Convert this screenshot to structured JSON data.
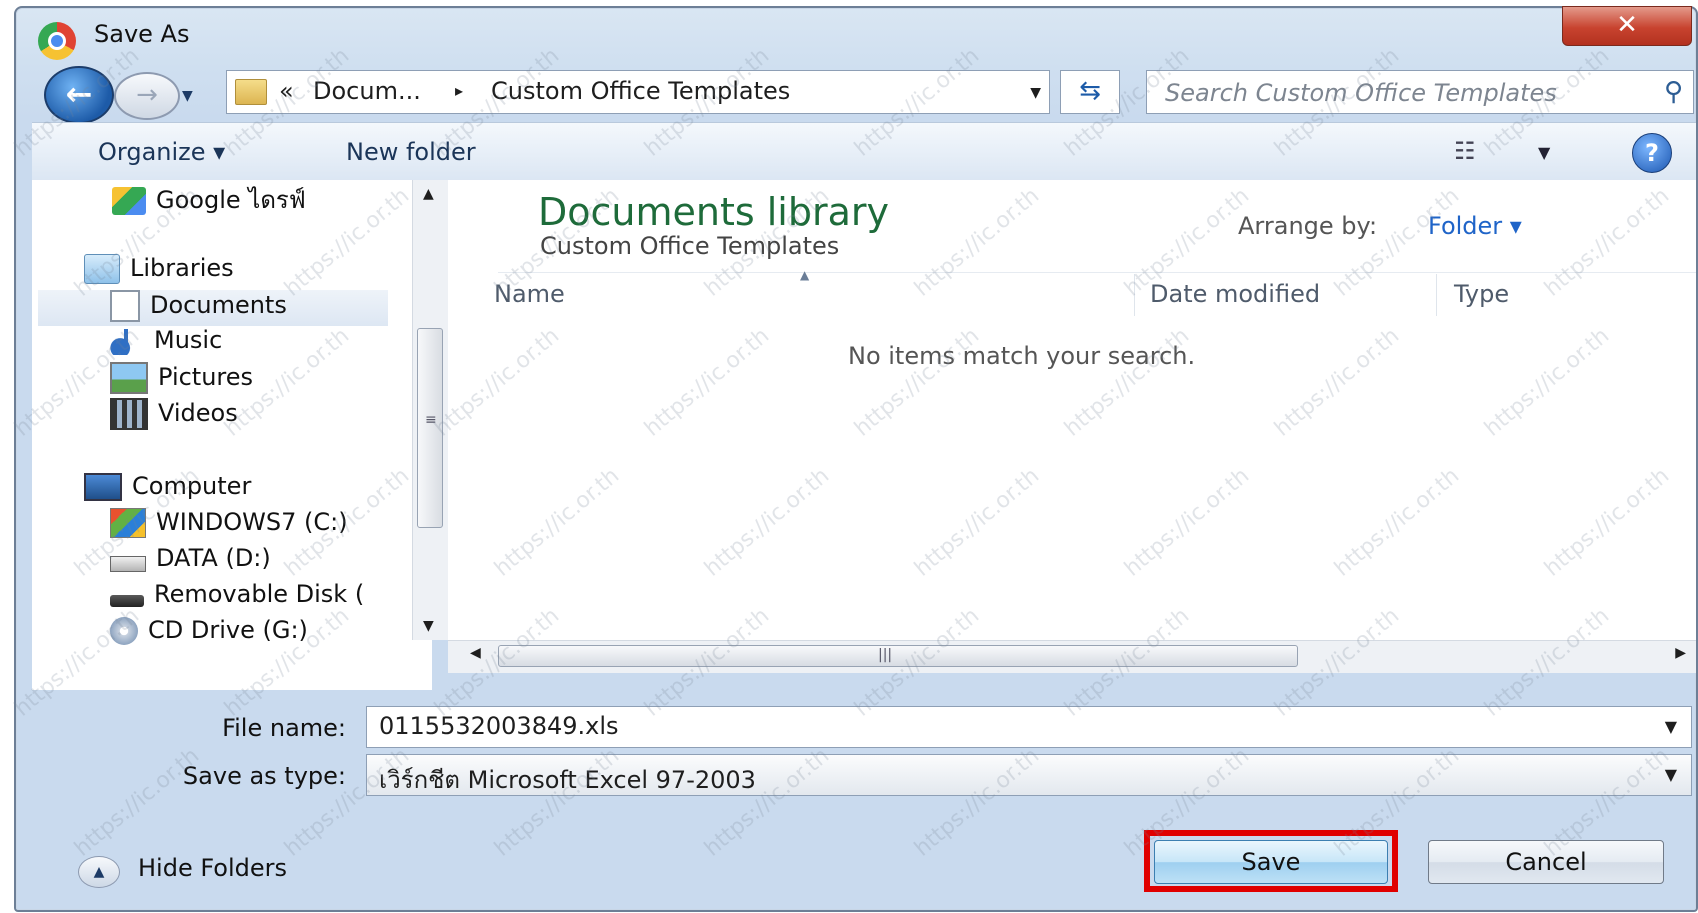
{
  "window": {
    "title": "Save As",
    "close_label": "✕"
  },
  "address_bar": {
    "overflow": "«",
    "parts": [
      "Docum...",
      "Custom Office Templates"
    ],
    "separator": "▸"
  },
  "search": {
    "placeholder": "Search Custom Office Templates"
  },
  "toolbar": {
    "organize": "Organize ▾",
    "new_folder": "New folder",
    "help": "?"
  },
  "nav_tree": [
    {
      "label": "Google ไดรฟ์",
      "icon": "google-drive-icon"
    },
    {
      "label": "Libraries",
      "icon": "libraries-icon"
    },
    {
      "label": "Documents",
      "icon": "documents-icon",
      "selected": true
    },
    {
      "label": "Music",
      "icon": "music-icon"
    },
    {
      "label": "Pictures",
      "icon": "pictures-icon"
    },
    {
      "label": "Videos",
      "icon": "videos-icon"
    },
    {
      "label": "Computer",
      "icon": "computer-icon"
    },
    {
      "label": "WINDOWS7 (C:)",
      "icon": "windows-drive-icon"
    },
    {
      "label": "DATA (D:)",
      "icon": "hard-drive-icon"
    },
    {
      "label": "Removable Disk (",
      "icon": "removable-disk-icon"
    },
    {
      "label": "CD Drive (G:)",
      "icon": "cd-drive-icon"
    }
  ],
  "content": {
    "library_title": "Documents library",
    "library_subtitle": "Custom Office Templates",
    "arrange_label": "Arrange by:",
    "arrange_value": "Folder ▾",
    "columns": [
      "Name",
      "Date modified",
      "Type"
    ],
    "empty_message": "No items match your search."
  },
  "form": {
    "file_name_label": "File name:",
    "file_name_value": "0115532003849.xls",
    "save_type_label": "Save as type:",
    "save_type_value": "เวิร์กชีต Microsoft Excel 97-2003"
  },
  "footer": {
    "hide_folders": "Hide Folders",
    "save": "Save",
    "cancel": "Cancel"
  },
  "watermark_text": "https://ic.or.th",
  "colors": {
    "highlight": "#e00000",
    "library_title": "#1e6b3a",
    "link": "#1f64c8"
  }
}
